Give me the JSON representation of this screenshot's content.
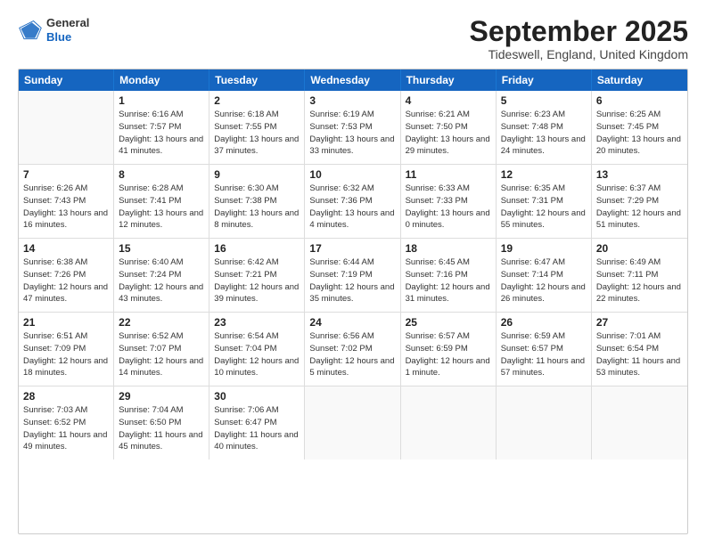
{
  "header": {
    "logo_line1": "General",
    "logo_line2": "Blue",
    "month_title": "September 2025",
    "location": "Tideswell, England, United Kingdom"
  },
  "weekdays": [
    "Sunday",
    "Monday",
    "Tuesday",
    "Wednesday",
    "Thursday",
    "Friday",
    "Saturday"
  ],
  "rows": [
    [
      {
        "day": "",
        "sunrise": "",
        "sunset": "",
        "daylight": ""
      },
      {
        "day": "1",
        "sunrise": "Sunrise: 6:16 AM",
        "sunset": "Sunset: 7:57 PM",
        "daylight": "Daylight: 13 hours and 41 minutes."
      },
      {
        "day": "2",
        "sunrise": "Sunrise: 6:18 AM",
        "sunset": "Sunset: 7:55 PM",
        "daylight": "Daylight: 13 hours and 37 minutes."
      },
      {
        "day": "3",
        "sunrise": "Sunrise: 6:19 AM",
        "sunset": "Sunset: 7:53 PM",
        "daylight": "Daylight: 13 hours and 33 minutes."
      },
      {
        "day": "4",
        "sunrise": "Sunrise: 6:21 AM",
        "sunset": "Sunset: 7:50 PM",
        "daylight": "Daylight: 13 hours and 29 minutes."
      },
      {
        "day": "5",
        "sunrise": "Sunrise: 6:23 AM",
        "sunset": "Sunset: 7:48 PM",
        "daylight": "Daylight: 13 hours and 24 minutes."
      },
      {
        "day": "6",
        "sunrise": "Sunrise: 6:25 AM",
        "sunset": "Sunset: 7:45 PM",
        "daylight": "Daylight: 13 hours and 20 minutes."
      }
    ],
    [
      {
        "day": "7",
        "sunrise": "Sunrise: 6:26 AM",
        "sunset": "Sunset: 7:43 PM",
        "daylight": "Daylight: 13 hours and 16 minutes."
      },
      {
        "day": "8",
        "sunrise": "Sunrise: 6:28 AM",
        "sunset": "Sunset: 7:41 PM",
        "daylight": "Daylight: 13 hours and 12 minutes."
      },
      {
        "day": "9",
        "sunrise": "Sunrise: 6:30 AM",
        "sunset": "Sunset: 7:38 PM",
        "daylight": "Daylight: 13 hours and 8 minutes."
      },
      {
        "day": "10",
        "sunrise": "Sunrise: 6:32 AM",
        "sunset": "Sunset: 7:36 PM",
        "daylight": "Daylight: 13 hours and 4 minutes."
      },
      {
        "day": "11",
        "sunrise": "Sunrise: 6:33 AM",
        "sunset": "Sunset: 7:33 PM",
        "daylight": "Daylight: 13 hours and 0 minutes."
      },
      {
        "day": "12",
        "sunrise": "Sunrise: 6:35 AM",
        "sunset": "Sunset: 7:31 PM",
        "daylight": "Daylight: 12 hours and 55 minutes."
      },
      {
        "day": "13",
        "sunrise": "Sunrise: 6:37 AM",
        "sunset": "Sunset: 7:29 PM",
        "daylight": "Daylight: 12 hours and 51 minutes."
      }
    ],
    [
      {
        "day": "14",
        "sunrise": "Sunrise: 6:38 AM",
        "sunset": "Sunset: 7:26 PM",
        "daylight": "Daylight: 12 hours and 47 minutes."
      },
      {
        "day": "15",
        "sunrise": "Sunrise: 6:40 AM",
        "sunset": "Sunset: 7:24 PM",
        "daylight": "Daylight: 12 hours and 43 minutes."
      },
      {
        "day": "16",
        "sunrise": "Sunrise: 6:42 AM",
        "sunset": "Sunset: 7:21 PM",
        "daylight": "Daylight: 12 hours and 39 minutes."
      },
      {
        "day": "17",
        "sunrise": "Sunrise: 6:44 AM",
        "sunset": "Sunset: 7:19 PM",
        "daylight": "Daylight: 12 hours and 35 minutes."
      },
      {
        "day": "18",
        "sunrise": "Sunrise: 6:45 AM",
        "sunset": "Sunset: 7:16 PM",
        "daylight": "Daylight: 12 hours and 31 minutes."
      },
      {
        "day": "19",
        "sunrise": "Sunrise: 6:47 AM",
        "sunset": "Sunset: 7:14 PM",
        "daylight": "Daylight: 12 hours and 26 minutes."
      },
      {
        "day": "20",
        "sunrise": "Sunrise: 6:49 AM",
        "sunset": "Sunset: 7:11 PM",
        "daylight": "Daylight: 12 hours and 22 minutes."
      }
    ],
    [
      {
        "day": "21",
        "sunrise": "Sunrise: 6:51 AM",
        "sunset": "Sunset: 7:09 PM",
        "daylight": "Daylight: 12 hours and 18 minutes."
      },
      {
        "day": "22",
        "sunrise": "Sunrise: 6:52 AM",
        "sunset": "Sunset: 7:07 PM",
        "daylight": "Daylight: 12 hours and 14 minutes."
      },
      {
        "day": "23",
        "sunrise": "Sunrise: 6:54 AM",
        "sunset": "Sunset: 7:04 PM",
        "daylight": "Daylight: 12 hours and 10 minutes."
      },
      {
        "day": "24",
        "sunrise": "Sunrise: 6:56 AM",
        "sunset": "Sunset: 7:02 PM",
        "daylight": "Daylight: 12 hours and 5 minutes."
      },
      {
        "day": "25",
        "sunrise": "Sunrise: 6:57 AM",
        "sunset": "Sunset: 6:59 PM",
        "daylight": "Daylight: 12 hours and 1 minute."
      },
      {
        "day": "26",
        "sunrise": "Sunrise: 6:59 AM",
        "sunset": "Sunset: 6:57 PM",
        "daylight": "Daylight: 11 hours and 57 minutes."
      },
      {
        "day": "27",
        "sunrise": "Sunrise: 7:01 AM",
        "sunset": "Sunset: 6:54 PM",
        "daylight": "Daylight: 11 hours and 53 minutes."
      }
    ],
    [
      {
        "day": "28",
        "sunrise": "Sunrise: 7:03 AM",
        "sunset": "Sunset: 6:52 PM",
        "daylight": "Daylight: 11 hours and 49 minutes."
      },
      {
        "day": "29",
        "sunrise": "Sunrise: 7:04 AM",
        "sunset": "Sunset: 6:50 PM",
        "daylight": "Daylight: 11 hours and 45 minutes."
      },
      {
        "day": "30",
        "sunrise": "Sunrise: 7:06 AM",
        "sunset": "Sunset: 6:47 PM",
        "daylight": "Daylight: 11 hours and 40 minutes."
      },
      {
        "day": "",
        "sunrise": "",
        "sunset": "",
        "daylight": ""
      },
      {
        "day": "",
        "sunrise": "",
        "sunset": "",
        "daylight": ""
      },
      {
        "day": "",
        "sunrise": "",
        "sunset": "",
        "daylight": ""
      },
      {
        "day": "",
        "sunrise": "",
        "sunset": "",
        "daylight": ""
      }
    ]
  ]
}
